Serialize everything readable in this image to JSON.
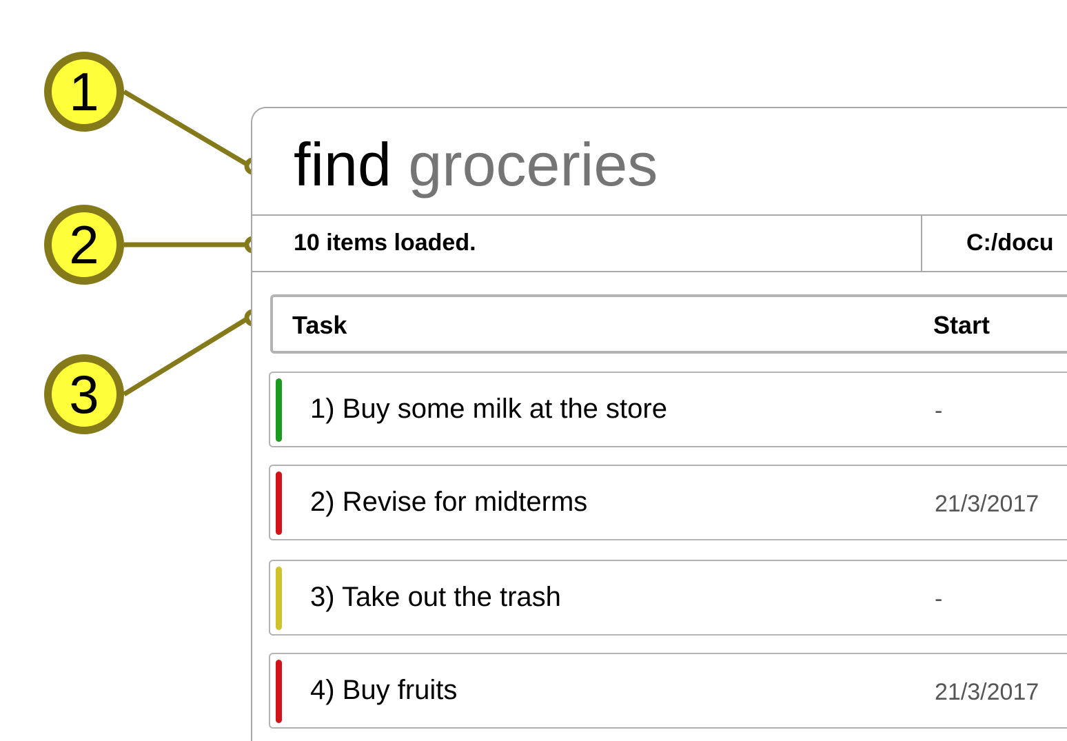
{
  "callouts": [
    {
      "number": "1"
    },
    {
      "number": "2"
    },
    {
      "number": "3"
    }
  ],
  "command": {
    "keyword": "find",
    "argument": "groceries"
  },
  "status": {
    "message": "10 items loaded.",
    "path": "C:/docu"
  },
  "table": {
    "columns": {
      "task": "Task",
      "start": "Start"
    },
    "rows": [
      {
        "name": "1) Buy some milk at the store",
        "start": "-",
        "priority_color": "#1a9a1f"
      },
      {
        "name": "2) Revise for midterms",
        "start": "21/3/2017",
        "priority_color": "#d0141a"
      },
      {
        "name": "3) Take out the trash",
        "start": "-",
        "priority_color": "#cfc22a"
      },
      {
        "name": "4) Buy fruits",
        "start": "21/3/2017",
        "priority_color": "#d0141a"
      }
    ]
  },
  "colors": {
    "callout_fill": "#fefe3a",
    "callout_stroke": "#847a1a",
    "border": "#a8a8a8"
  }
}
